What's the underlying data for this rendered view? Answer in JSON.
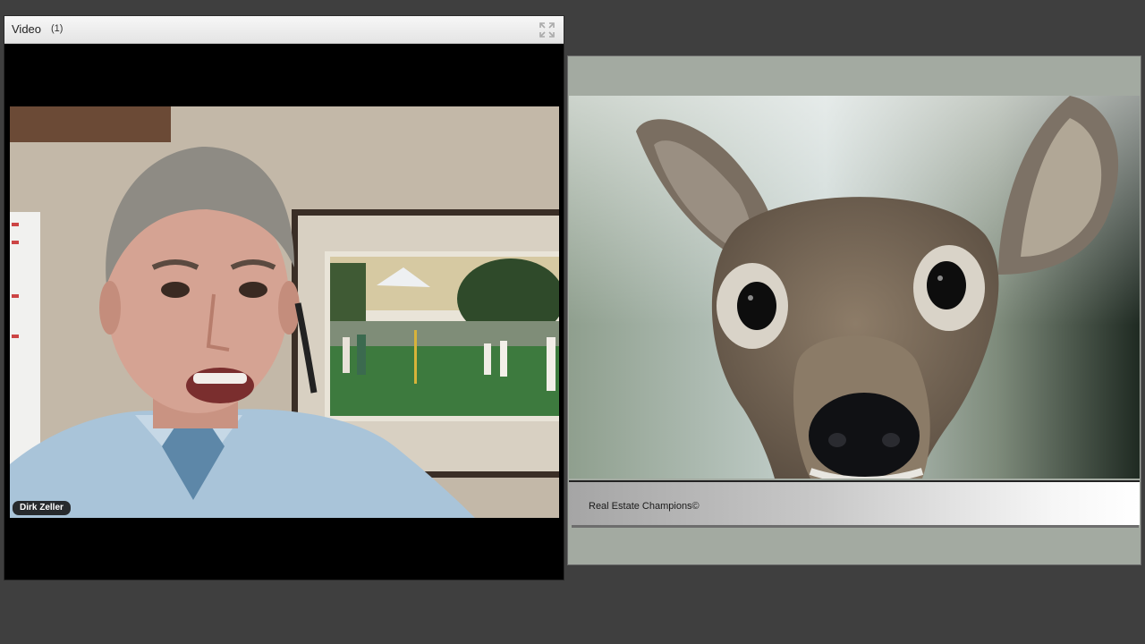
{
  "video_pod": {
    "title": "Video",
    "count": "(1)",
    "icons": {
      "fullscreen": "fullscreen-icon"
    },
    "participant": {
      "name": "Dirk Zeller"
    }
  },
  "share_pod": {
    "footer_text": "Real Estate Champions©"
  },
  "colors": {
    "background": "#3f3f3f",
    "pod_header": "#ececec",
    "share_frame": "#a3aaa1"
  }
}
